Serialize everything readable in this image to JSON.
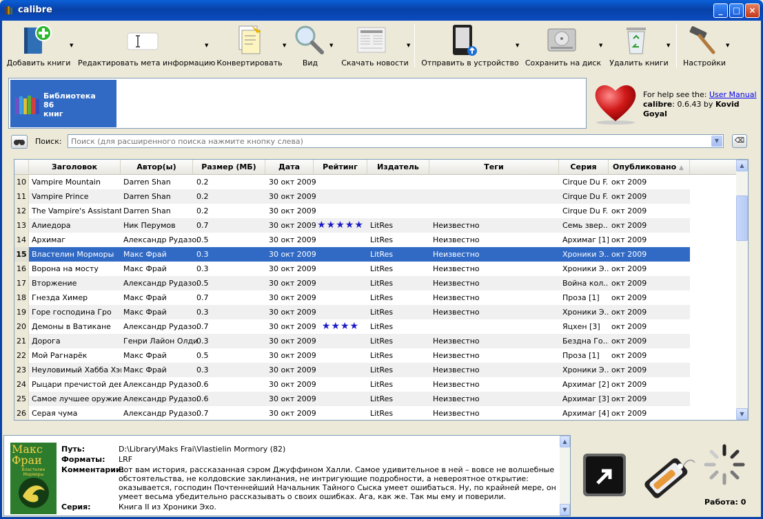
{
  "window": {
    "title": "calibre",
    "minimize": "_",
    "maximize": "□",
    "close": "×"
  },
  "toolbar": [
    {
      "name": "add-books",
      "label": "Добавить книги",
      "icon": "book-plus-icon"
    },
    {
      "name": "edit-meta",
      "label": "Редактировать мета информацию",
      "icon": "edit-cursor-icon"
    },
    {
      "name": "convert",
      "label": "Конвертировать",
      "icon": "convert-icon"
    },
    {
      "name": "view",
      "label": "Вид",
      "icon": "magnifier-icon"
    },
    {
      "name": "fetch-news",
      "label": "Скачать новости",
      "icon": "newspaper-icon"
    },
    {
      "name": "send-device",
      "label": "Отправить в устройство",
      "icon": "ereader-icon"
    },
    {
      "name": "save-disk",
      "label": "Сохранить на диск",
      "icon": "harddisk-icon"
    },
    {
      "name": "delete-books",
      "label": "Удалить книги",
      "icon": "recycle-bin-icon"
    },
    {
      "name": "preferences",
      "label": "Настройки",
      "icon": "hammer-icon"
    }
  ],
  "library": {
    "line1": "Библиотека",
    "line2": "86",
    "line3": "книг"
  },
  "help": {
    "prefix": "For help see the: ",
    "link": "User Manual",
    "app": "calibre",
    "version": ": 0.6.43 by ",
    "author": "Kovid Goyal"
  },
  "search": {
    "label": "Поиск:",
    "placeholder": "Поиск (для расширенного поиска нажмите кнопку слева)"
  },
  "columns": [
    "Заголовок",
    "Автор(ы)",
    "Размер (МБ)",
    "Дата",
    "Рейтинг",
    "Издатель",
    "Теги",
    "Серия",
    "Опубликовано"
  ],
  "rows": [
    {
      "n": "10",
      "title": "Vampire Mountain",
      "author": "Darren Shan",
      "size": "0.2",
      "date": "30 окт 2009",
      "rating": 0,
      "publisher": "",
      "tags": "",
      "series": "Cirque Du F...",
      "pub": "окт 2009"
    },
    {
      "n": "11",
      "title": "Vampire Prince",
      "author": "Darren Shan",
      "size": "0.2",
      "date": "30 окт 2009",
      "rating": 0,
      "publisher": "",
      "tags": "",
      "series": "Cirque Du F...",
      "pub": "окт 2009"
    },
    {
      "n": "12",
      "title": "The Vampire's Assistant",
      "author": "Darren Shan",
      "size": "0.2",
      "date": "30 окт 2009",
      "rating": 0,
      "publisher": "",
      "tags": "",
      "series": "Cirque Du F...",
      "pub": "окт 2009"
    },
    {
      "n": "13",
      "title": "Алиедора",
      "author": "Ник Перумов",
      "size": "0.7",
      "date": "30 окт 2009",
      "rating": 5,
      "publisher": "LitRes",
      "tags": "Неизвестно",
      "series": "Семь звер...",
      "pub": "окт 2009"
    },
    {
      "n": "14",
      "title": "Архимаг",
      "author": "Александр Рудазов",
      "size": "0.5",
      "date": "30 окт 2009",
      "rating": 0,
      "publisher": "LitRes",
      "tags": "Неизвестно",
      "series": "Архимаг [1]",
      "pub": "окт 2009"
    },
    {
      "n": "15",
      "title": "Властелин Морморы",
      "author": "Макс Фрай",
      "size": "0.3",
      "date": "30 окт 2009",
      "rating": 0,
      "publisher": "LitRes",
      "tags": "Неизвестно",
      "series": "Хроники Э...",
      "pub": "окт 2009"
    },
    {
      "n": "16",
      "title": "Ворона на мосту",
      "author": "Макс Фрай",
      "size": "0.3",
      "date": "30 окт 2009",
      "rating": 0,
      "publisher": "LitRes",
      "tags": "Неизвестно",
      "series": "Хроники Э...",
      "pub": "окт 2009"
    },
    {
      "n": "17",
      "title": "Вторжение",
      "author": "Александр Рудазов",
      "size": "0.5",
      "date": "30 окт 2009",
      "rating": 0,
      "publisher": "LitRes",
      "tags": "Неизвестно",
      "series": "Война кол...",
      "pub": "окт 2009"
    },
    {
      "n": "18",
      "title": "Гнезда Химер",
      "author": "Макс Фрай",
      "size": "0.7",
      "date": "30 окт 2009",
      "rating": 0,
      "publisher": "LitRes",
      "tags": "Неизвестно",
      "series": "Проза [1]",
      "pub": "окт 2009"
    },
    {
      "n": "19",
      "title": "Горе господина Гро",
      "author": "Макс Фрай",
      "size": "0.3",
      "date": "30 окт 2009",
      "rating": 0,
      "publisher": "LitRes",
      "tags": "Неизвестно",
      "series": "Хроники Э...",
      "pub": "окт 2009"
    },
    {
      "n": "20",
      "title": "Демоны в Ватикане",
      "author": "Александр Рудазов",
      "size": "0.7",
      "date": "30 окт 2009",
      "rating": 4,
      "publisher": "LitRes",
      "tags": "",
      "series": "Яцхен [3]",
      "pub": "окт 2009"
    },
    {
      "n": "21",
      "title": "Дорога",
      "author": "Генри Лайон Олди",
      "size": "0.3",
      "date": "30 окт 2009",
      "rating": 0,
      "publisher": "LitRes",
      "tags": "Неизвестно",
      "series": "Бездна Го...",
      "pub": "окт 2009"
    },
    {
      "n": "22",
      "title": "Мой Рагнарёк",
      "author": "Макс Фрай",
      "size": "0.5",
      "date": "30 окт 2009",
      "rating": 0,
      "publisher": "LitRes",
      "tags": "Неизвестно",
      "series": "Проза [1]",
      "pub": "окт 2009"
    },
    {
      "n": "23",
      "title": "Неуловимый Хабба Хэн",
      "author": "Макс Фрай",
      "size": "0.3",
      "date": "30 окт 2009",
      "rating": 0,
      "publisher": "LitRes",
      "tags": "Неизвестно",
      "series": "Хроники Э...",
      "pub": "окт 2009"
    },
    {
      "n": "24",
      "title": "Рыцари пречистой девы",
      "author": "Александр Рудазов",
      "size": "0.6",
      "date": "30 окт 2009",
      "rating": 0,
      "publisher": "LitRes",
      "tags": "Неизвестно",
      "series": "Архимаг [2]",
      "pub": "окт 2009"
    },
    {
      "n": "25",
      "title": "Самое лучшее оружие",
      "author": "Александр Рудазов",
      "size": "0.6",
      "date": "30 окт 2009",
      "rating": 0,
      "publisher": "LitRes",
      "tags": "Неизвестно",
      "series": "Архимаг [3]",
      "pub": "окт 2009"
    },
    {
      "n": "26",
      "title": "Серая чума",
      "author": "Александр Рудазов",
      "size": "0.7",
      "date": "30 окт 2009",
      "rating": 0,
      "publisher": "LitRes",
      "tags": "Неизвестно",
      "series": "Архимаг [4]",
      "pub": "окт 2009"
    }
  ],
  "selected_row": "15",
  "details": {
    "cover_author": "Макс Фраи",
    "cover_title": "Властелин Морморы",
    "path_label": "Путь:",
    "path_value": "D:\\Library\\Maks Frai\\Vlastielin Mormory (82)",
    "formats_label": "Форматы:",
    "formats_value": "LRF",
    "comments_label": "Комментарии:",
    "comments_value": "Вот вам история, рассказанная сэром Джуффином Халли. Самое удивительное в ней – вовсе не волшебные обстоятельства, не колдовские заклинания, не интригующие подробности, а невероятное открытие: оказывается, господин Почтеннейший Начальник Тайного Сыска умеет ошибаться. Ну, по крайней мере, он умеет весьма убедительно рассказывать о своих ошибках. Ага, как же. Так мы ему и поверили.",
    "series_label": "Серия:",
    "series_value": "Книга II из Хроники Эхо."
  },
  "jobs": {
    "label": "Работа: 0"
  },
  "colors": {
    "selection": "#316ac5",
    "titlebar": "#0842a8",
    "star": "#1a1ac8"
  }
}
